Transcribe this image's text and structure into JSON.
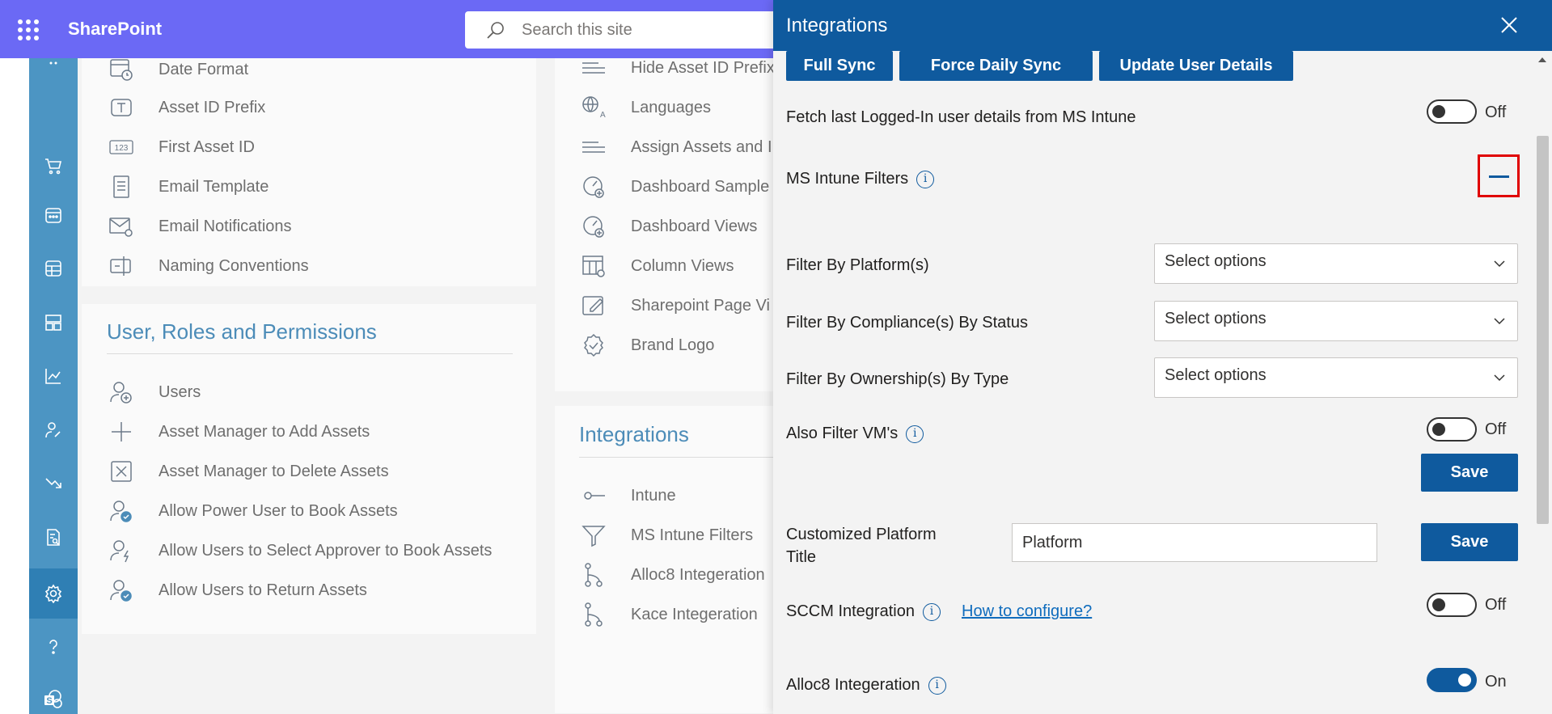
{
  "topbar": {
    "app_name": "SharePoint",
    "search_placeholder": "Search this site",
    "color": "#6b69f5"
  },
  "rail": {
    "items": [
      "apps-grid-icon",
      "cart-icon",
      "calendar-icon",
      "table-icon",
      "dashboard-icon",
      "chart-icon",
      "user-wrench-icon",
      "trend-down-icon",
      "report-search-icon",
      "settings-icon",
      "help-icon",
      "sharepoint-icon"
    ],
    "active": "settings-icon"
  },
  "background": {
    "left_list": [
      "Date Format",
      "Asset ID Prefix",
      "First Asset ID",
      "Email Template",
      "Email Notifications",
      "Naming Conventions"
    ],
    "users_section": {
      "title": "User, Roles and Permissions",
      "items": [
        "Users",
        "Asset Manager to Add Assets",
        "Asset Manager to Delete Assets",
        "Allow Power User to Book Assets",
        "Allow Users to Select Approver to Book Assets",
        "Allow Users to Return Assets"
      ]
    },
    "right_list": [
      "Hide Asset ID Prefix",
      "Languages",
      "Assign Assets and I",
      "Dashboard Sample",
      "Dashboard Views",
      "Column Views",
      "Sharepoint Page Vi",
      "Brand Logo"
    ],
    "integrations_section": {
      "title": "Integrations",
      "items": [
        "Intune",
        "MS Intune Filters",
        "Alloc8 Integeration",
        "Kace Integeration"
      ]
    }
  },
  "panel": {
    "title": "Integrations",
    "buttons": {
      "full_sync": "Full Sync",
      "force_daily_sync": "Force Daily Sync",
      "update_user_details": "Update User Details"
    },
    "fetch_last_logged": {
      "label": "Fetch last Logged-In user details from MS Intune",
      "state": "Off"
    },
    "ms_intune_filters": {
      "label": "MS Intune Filters"
    },
    "filters": [
      {
        "label": "Filter By Platform(s)",
        "value": "Select options"
      },
      {
        "label": "Filter By Compliance(s) By Status",
        "value": "Select options"
      },
      {
        "label": "Filter By Ownership(s) By Type",
        "value": "Select options"
      }
    ],
    "also_filter_vms": {
      "label": "Also Filter VM's",
      "state": "Off"
    },
    "save_label": "Save",
    "customized_platform": {
      "label_line1": "Customized Platform",
      "label_line2": "Title",
      "value": "Platform"
    },
    "sccm": {
      "label": "SCCM Integration",
      "link": "How to configure?",
      "state": "Off"
    },
    "alloc8": {
      "label": "Alloc8 Integeration",
      "state": "On"
    },
    "accent": "#0f5a9e"
  }
}
